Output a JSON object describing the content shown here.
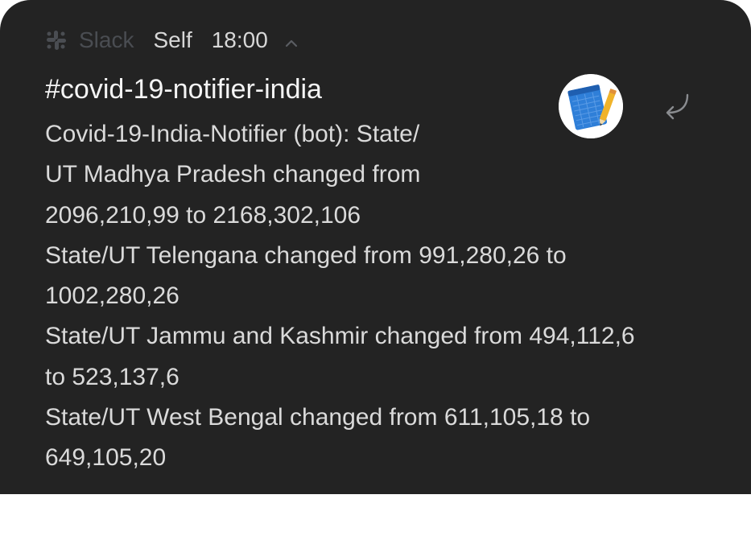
{
  "notification": {
    "app_name": "Slack",
    "sender": "Self",
    "time": "18:00",
    "title": "#covid-19-notifier-india",
    "body_lines": [
      "Covid-19-India-Notifier (bot): State/",
      "UT Madhya Pradesh changed from",
      "2096,210,99 to 2168,302,106",
      "State/UT Telengana changed from 991,280,26 to",
      "1002,280,26",
      "State/UT Jammu and Kashmir changed from 494,112,6",
      "to 523,137,6",
      "State/UT West Bengal changed from 611,105,18 to",
      "649,105,20"
    ]
  },
  "icons": {
    "app": "slack-icon",
    "expand": "chevron-up-icon",
    "avatar": "notepad-avatar-icon",
    "reply": "reply-arrow-icon"
  },
  "colors": {
    "card_background": "#232323",
    "app_name_text": "#4a4d52",
    "primary_text": "#f4f4f4",
    "body_text": "#dadada",
    "avatar_blue": "#2f7fd8",
    "avatar_pencil": "#f0b32a"
  }
}
